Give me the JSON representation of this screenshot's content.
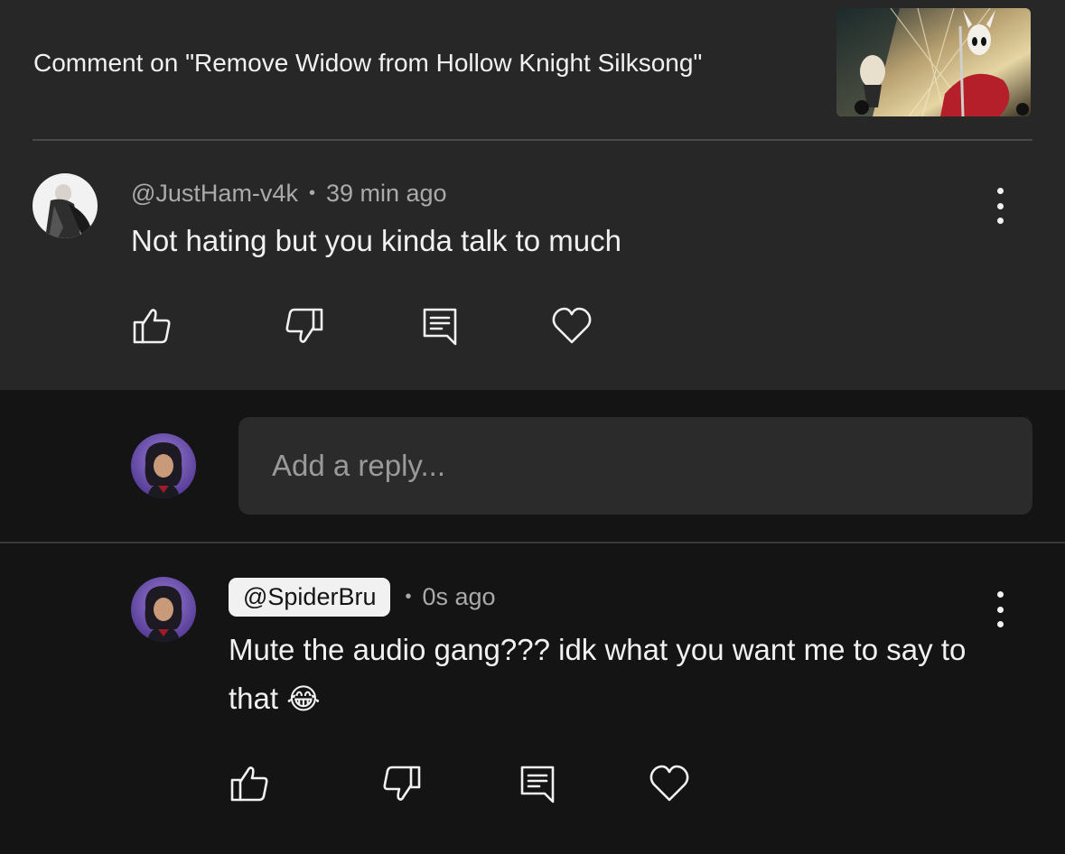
{
  "context": {
    "title": "Comment on \"Remove Widow from Hollow Knight Silksong\"",
    "thumbnail_icon": "video-thumbnail"
  },
  "comment": {
    "author": "@JustHam-v4k",
    "separator": "•",
    "time": "39 min ago",
    "text": "Not hating but you kinda talk to much",
    "avatar_icon": "user-avatar"
  },
  "composer": {
    "placeholder": "Add a reply..."
  },
  "reply": {
    "author": "@SpiderBru",
    "separator": "•",
    "time": "0s ago",
    "text": "Mute the audio gang??? idk what you want me to say to that",
    "emoji": "😂"
  },
  "colors": {
    "top_bg": "#272727",
    "bottom_bg": "#141414",
    "text_primary": "#f1f1f1",
    "text_secondary": "#aaaaaa"
  }
}
